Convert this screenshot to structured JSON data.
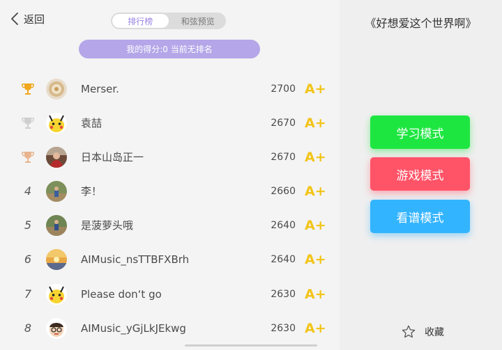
{
  "header": {
    "back_label": "返回"
  },
  "tabs": [
    {
      "label": "排行榜",
      "active": true
    },
    {
      "label": "和弦预览",
      "active": false
    }
  ],
  "my_score": "我的得分:0 当前无排名",
  "leaderboard": [
    {
      "rank": "1",
      "medal": "gold-trophy-icon",
      "avatar": "coin-avatar",
      "name": "Merser.",
      "score": "2700",
      "grade": "A+"
    },
    {
      "rank": "2",
      "medal": "silver-trophy-icon",
      "avatar": "pikachu-avatar",
      "name": "袁喆",
      "score": "2670",
      "grade": "A+"
    },
    {
      "rank": "3",
      "medal": "bronze-trophy-icon",
      "avatar": "person-avatar",
      "name": "日本山岛正一",
      "score": "2670",
      "grade": "A+"
    },
    {
      "rank": "4",
      "medal": "",
      "avatar": "outdoor-avatar",
      "name": "李！",
      "score": "2660",
      "grade": "A+"
    },
    {
      "rank": "5",
      "medal": "",
      "avatar": "outdoor-avatar",
      "name": "是菠萝头哦",
      "score": "2640",
      "grade": "A+"
    },
    {
      "rank": "6",
      "medal": "",
      "avatar": "sunset-avatar",
      "name": "AIMusic_nsTTBFXBrh",
      "score": "2640",
      "grade": "A+"
    },
    {
      "rank": "7",
      "medal": "",
      "avatar": "pikachu-avatar",
      "name": "Please don‘t go",
      "score": "2630",
      "grade": "A+"
    },
    {
      "rank": "8",
      "medal": "",
      "avatar": "cartoon-boy-avatar",
      "name": "AIMusic_yGjLkJEkwg",
      "score": "2630",
      "grade": "A+"
    }
  ],
  "song_title": "《好想爱这个世界啊》",
  "modes": {
    "learn": "学习模式",
    "game": "游戏模式",
    "score": "看谱模式"
  },
  "favorite_label": "收藏",
  "colors": {
    "accent_purple": "#9a82e2",
    "grade_gold": "#f2c418",
    "learn_green": "#1ee641",
    "game_red": "#ff5468",
    "score_blue": "#33b4ff"
  }
}
